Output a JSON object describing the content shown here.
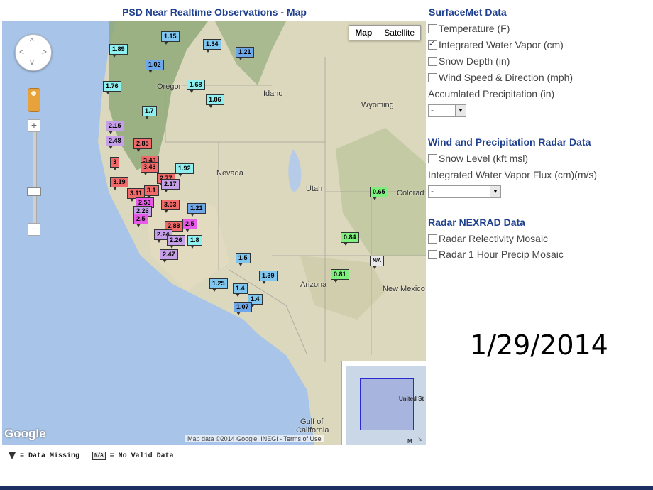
{
  "map": {
    "title": "PSD Near Realtime Observations - Map",
    "type_buttons": [
      "Map",
      "Satellite"
    ],
    "places": [
      "Oregon",
      "Idaho",
      "Wyoming",
      "Nevada",
      "Utah",
      "Colorad",
      "Arizona",
      "New Mexico",
      "Gulf of",
      "California"
    ],
    "overview_labels": [
      "United St",
      "M"
    ],
    "logo": "Google",
    "attribution": "Map data ©2014 Google, INEGI - ",
    "terms": "Terms of Use"
  },
  "stations": [
    {
      "v": "1.15",
      "c": "#7fc7f0"
    },
    {
      "v": "1.89",
      "c": "#8ff0f0"
    },
    {
      "v": "1.34",
      "c": "#7fc7f0"
    },
    {
      "v": "1.21",
      "c": "#6fa8ea"
    },
    {
      "v": "1.02",
      "c": "#6fa8ea"
    },
    {
      "v": "1.76",
      "c": "#8ff0f0"
    },
    {
      "v": "1.68",
      "c": "#8ff0f0"
    },
    {
      "v": "1.86",
      "c": "#8ff0f0"
    },
    {
      "v": "1.7",
      "c": "#8ff0f0"
    },
    {
      "v": "2.15",
      "c": "#c5a0e8"
    },
    {
      "v": "2.48",
      "c": "#c5a0e8"
    },
    {
      "v": "2.85",
      "c": "#f06a6a"
    },
    {
      "v": "3",
      "c": "#f06a6a"
    },
    {
      "v": "3.43",
      "c": "#f06a6a"
    },
    {
      "v": "3.43",
      "c": "#f06a6a"
    },
    {
      "v": "2.77",
      "c": "#f06a6a"
    },
    {
      "v": "1.92",
      "c": "#8ff0f0"
    },
    {
      "v": "2.17",
      "c": "#c5a0e8"
    },
    {
      "v": "3.19",
      "c": "#f06a6a"
    },
    {
      "v": "3.11",
      "c": "#f06a6a"
    },
    {
      "v": "3.1",
      "c": "#f06a6a"
    },
    {
      "v": "2.53",
      "c": "#e85ae8"
    },
    {
      "v": "3.03",
      "c": "#f06a6a"
    },
    {
      "v": "1.21",
      "c": "#6fa8ea"
    },
    {
      "v": "2.26",
      "c": "#c5a0e8"
    },
    {
      "v": "2.5",
      "c": "#e85ae8"
    },
    {
      "v": "2.88",
      "c": "#f06a6a"
    },
    {
      "v": "2.5",
      "c": "#e85ae8"
    },
    {
      "v": "2.24",
      "c": "#c5a0e8"
    },
    {
      "v": "2.26",
      "c": "#c5a0e8"
    },
    {
      "v": "1.8",
      "c": "#8ff0f0"
    },
    {
      "v": "2.47",
      "c": "#c5a0e8"
    },
    {
      "v": "1.5",
      "c": "#7fc7f0"
    },
    {
      "v": "1.39",
      "c": "#7fc7f0"
    },
    {
      "v": "1.25",
      "c": "#7fc7f0"
    },
    {
      "v": "1.4",
      "c": "#7fc7f0"
    },
    {
      "v": "1.4",
      "c": "#7fc7f0"
    },
    {
      "v": "1.07",
      "c": "#6fa8ea"
    },
    {
      "v": "0.65",
      "c": "#7ef07e"
    },
    {
      "v": "0.84",
      "c": "#7ef07e"
    },
    {
      "v": "0.81",
      "c": "#7ef07e"
    },
    {
      "v": "N/A",
      "c": "#e8e8e8"
    }
  ],
  "legend": {
    "missing": "= Data Missing",
    "na_badge": "N/A",
    "novalid": "= No Valid Data"
  },
  "sidebar": {
    "surface_title": "SurfaceMet Data",
    "surface_options": [
      {
        "label": "Temperature (F)",
        "checked": false
      },
      {
        "label": "Integrated Water Vapor (cm)",
        "checked": true
      },
      {
        "label": "Snow Depth (in)",
        "checked": false
      },
      {
        "label": "Wind Speed & Direction (mph)",
        "checked": false
      }
    ],
    "precip_label": "Accumlated Precipitation (in)",
    "precip_value": "-",
    "wind_title": "Wind and Precipitation Radar Data",
    "snow_level": "Snow Level (kft msl)",
    "ivt_label": "Integrated Water Vapor Flux (cm)(m/s)",
    "ivt_value": "-",
    "nexrad_title": "Radar NEXRAD Data",
    "nexrad_options": [
      {
        "label": "Radar Relectivity Mosaic",
        "checked": false
      },
      {
        "label": "Radar 1 Hour Precip Mosaic",
        "checked": false
      }
    ]
  },
  "date": "1/29/2014"
}
